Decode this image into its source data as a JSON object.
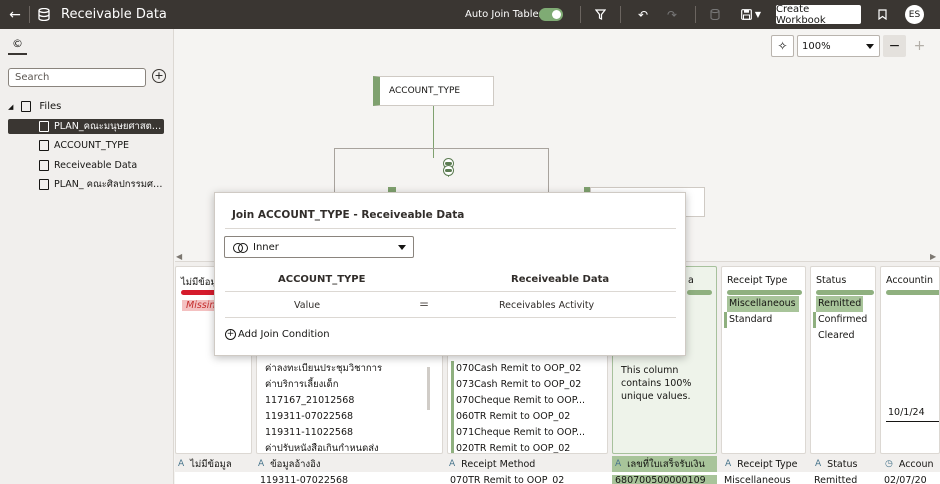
{
  "header": {
    "title": "Receivable Data",
    "auto_join_label": "Auto Join Tables",
    "auto_join_on": true,
    "create_workbook_label": "Create Workbook",
    "avatar_initials": "ES"
  },
  "left_panel": {
    "search_placeholder": "Search",
    "tree_root": "Files",
    "items": [
      {
        "label": "PLAN_คณะมนุษยศาสตร์แ...",
        "selected": true
      },
      {
        "label": "ACCOUNT_TYPE",
        "selected": false
      },
      {
        "label": "Receiveable Data",
        "selected": false
      },
      {
        "label": "PLAN_ คณะศิลปกรรมศาส...",
        "selected": false
      }
    ]
  },
  "canvas": {
    "zoom": "100%",
    "root_node": "ACCOUNT_TYPE"
  },
  "join_dialog": {
    "title": "Join ACCOUNT_TYPE - Receiveable Data",
    "join_type": "Inner",
    "left_header": "ACCOUNT_TYPE",
    "right_header": "Receiveable Data",
    "left_value": "Value",
    "operator": "=",
    "right_value": "Receivables Activity",
    "add_condition_label": "Add Join Condition"
  },
  "preview": {
    "cards": [
      {
        "title": "ไม่มีข้อมูล",
        "missing": "Missing"
      },
      {
        "values": [
          "ค่าลงทะเบียนประชุมวิชาการ",
          "ค่าบริการเลี้ยงเด็ก",
          "117167_21012568",
          "119311-07022568",
          "119311-11022568",
          "ค่าปรับหนังสือเกินกำหนดส่ง"
        ]
      },
      {
        "values": [
          "070Cash Remit to OOP_02",
          "073Cash Remit to OOP_02",
          "070Cheque Remit to OOP...",
          "060TR Remit to OOP_02",
          "071Cheque Remit to OOP...",
          "020TR Remit to OOP_02"
        ]
      },
      {
        "title_suffix": "a",
        "unique_text": "This column contains 100% unique values."
      },
      {
        "title": "Receipt Type",
        "values": [
          "Miscellaneous",
          "Standard"
        ]
      },
      {
        "title": "Status",
        "values": [
          "Remitted",
          "Confirmed",
          "Cleared"
        ]
      },
      {
        "title": "Accountin",
        "date_value": "10/1/24"
      }
    ],
    "columns": [
      {
        "type": "A",
        "label": "ไม่มีข้อมูล"
      },
      {
        "type": "A",
        "label": "ข้อมูลอ้างอิง"
      },
      {
        "type": "A",
        "label": "Receipt Method"
      },
      {
        "type": "A",
        "label": "เลขที่ใบเสร็จรับเงิน"
      },
      {
        "type": "A",
        "label": "Receipt Type"
      },
      {
        "type": "A",
        "label": "Status"
      },
      {
        "type": "◷",
        "label": "Accoun"
      }
    ],
    "first_row": [
      "",
      "119311-07022568",
      "070TR Remit to OOP_02",
      "680700500000109",
      "Miscellaneous",
      "Remitted",
      "02/07/20"
    ]
  },
  "colors": {
    "topbar": "#3a3632",
    "accent_green": "#7fa16f",
    "missing_red": "#d51b2c"
  }
}
